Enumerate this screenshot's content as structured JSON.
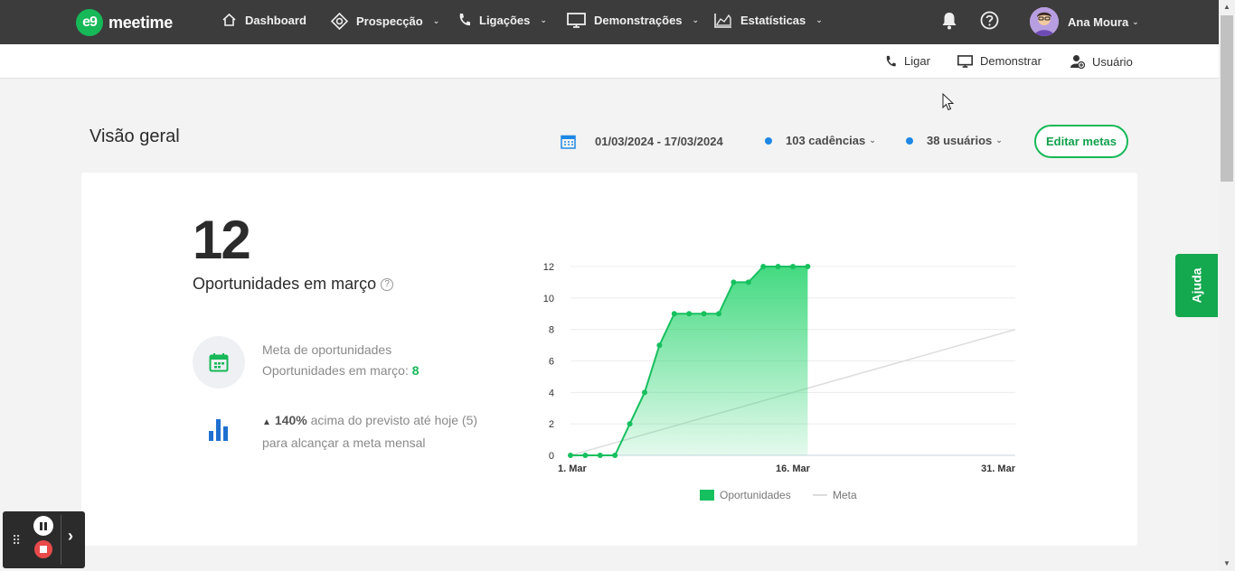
{
  "nav": {
    "logo_mark": "e9",
    "logo_text": "meetime",
    "items": [
      {
        "label": "Dashboard",
        "has_dropdown": false,
        "icon": "home-icon"
      },
      {
        "label": "Prospecção",
        "has_dropdown": true,
        "icon": "target-icon"
      },
      {
        "label": "Ligações",
        "has_dropdown": true,
        "icon": "phone-icon"
      },
      {
        "label": "Demonstrações",
        "has_dropdown": true,
        "icon": "monitor-icon"
      },
      {
        "label": "Estatísticas",
        "has_dropdown": true,
        "icon": "chart-icon"
      }
    ],
    "user_name": "Ana Moura"
  },
  "subbar": {
    "call": "Ligar",
    "demo": "Demonstrar",
    "user": "Usuário"
  },
  "header": {
    "title": "Visão geral",
    "date_range": "01/03/2024 - 17/03/2024",
    "cadences": "103 cadências",
    "users": "38 usuários",
    "edit_button": "Editar metas"
  },
  "summary": {
    "big_number": "12",
    "title": "Oportunidades em março",
    "goal_label": "Meta de oportunidades",
    "goal_value_label": "Oportunidades em março:",
    "goal_value": "8",
    "percent": "140%",
    "percent_text": "acima do previsto até hoje (5)",
    "percent_text2": "para alcançar a meta mensal"
  },
  "chart_data": {
    "type": "area",
    "x_tick_labels": [
      "1. Mar",
      "16. Mar",
      "31. Mar"
    ],
    "y_ticks": [
      0,
      2,
      4,
      6,
      8,
      10,
      12
    ],
    "ylim": [
      0,
      12
    ],
    "xlim": [
      1,
      31
    ],
    "series": [
      {
        "name": "Oportunidades",
        "type": "area",
        "color": "#17c05f",
        "x": [
          1,
          2,
          3,
          4,
          5,
          6,
          7,
          8,
          9,
          10,
          11,
          12,
          13,
          14,
          15,
          16,
          17
        ],
        "values": [
          0,
          0,
          0,
          0,
          2,
          4,
          7,
          9,
          9,
          9,
          9,
          11,
          11,
          12,
          12,
          12,
          12
        ]
      },
      {
        "name": "Meta",
        "type": "line",
        "color": "#dddddd",
        "x": [
          1,
          31
        ],
        "values": [
          0,
          8
        ]
      }
    ],
    "legend": [
      "Oportunidades",
      "Meta"
    ],
    "grid": true
  },
  "ajuda_label": "Ajuda"
}
